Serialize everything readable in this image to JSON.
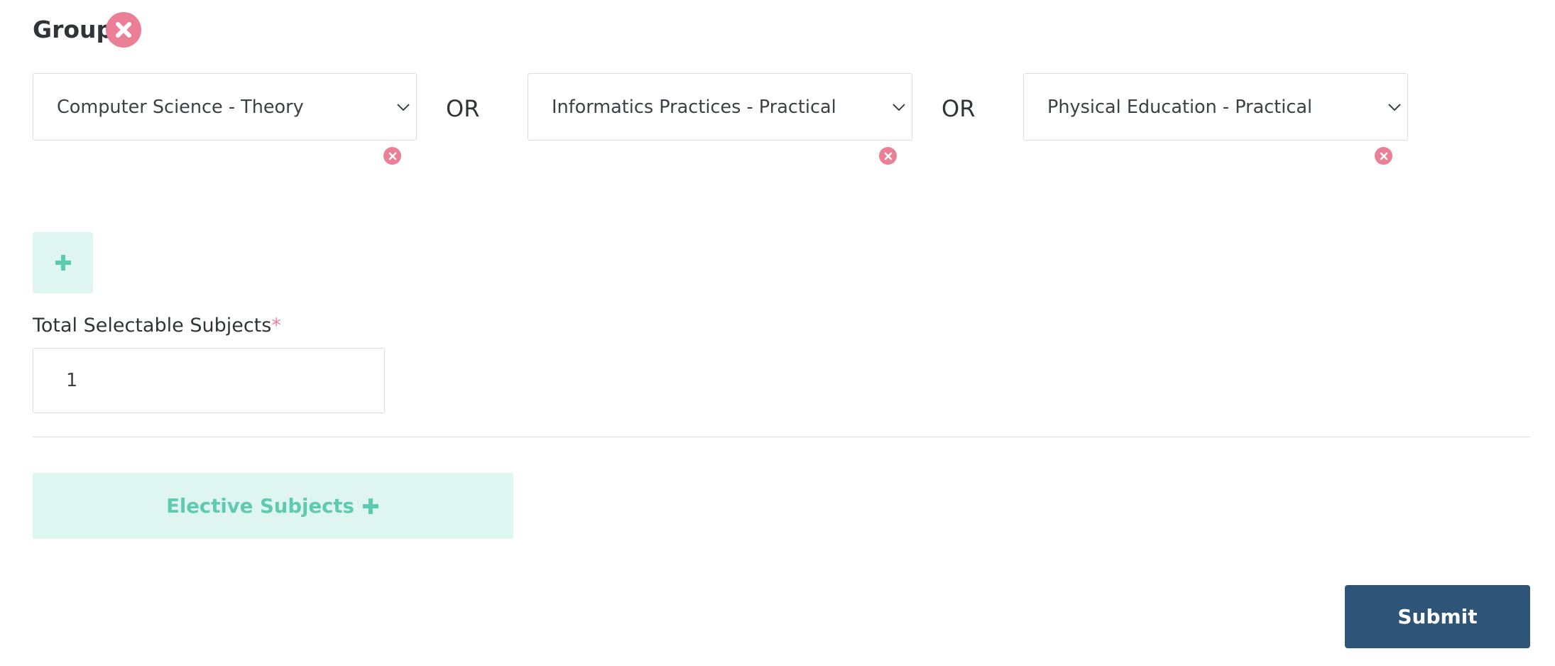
{
  "group": {
    "title": "Group",
    "remove_icon": "close-circle-icon"
  },
  "subject_selects": [
    {
      "value": "Computer Science - Theory"
    },
    {
      "value": "Informatics Practices - Practical"
    },
    {
      "value": "Physical Education - Practical"
    }
  ],
  "or_label": "OR",
  "add_subject_icon": "plus-icon",
  "total_selectable": {
    "label": "Total Selectable Subjects",
    "required_marker": "*",
    "value": "1"
  },
  "elective_button": {
    "label": "Elective Subjects",
    "icon": "plus-icon"
  },
  "submit_label": "Submit",
  "colors": {
    "accent_teal": "#5ecbb0",
    "teal_bg": "#dff5ef",
    "danger_pink": "#eb7f95",
    "primary_navy": "#2e5577"
  }
}
